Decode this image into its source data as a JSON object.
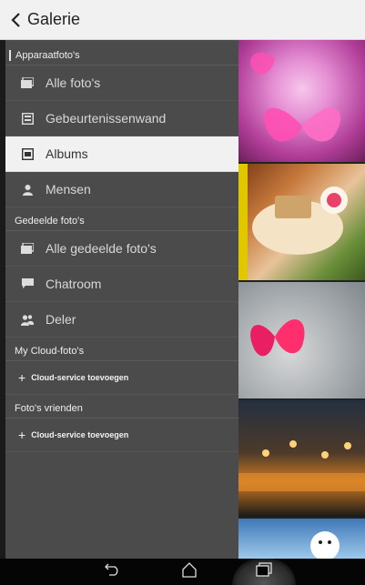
{
  "header": {
    "back_icon": "chevron-left-icon",
    "title": "Galerie"
  },
  "drawer": {
    "sections": [
      {
        "title": "Apparaatfoto's",
        "items": [
          {
            "label": "Alle foto's",
            "icon": "photos-icon"
          },
          {
            "label": "Gebeurtenissenwand",
            "icon": "event-wall-icon"
          },
          {
            "label": "Albums",
            "icon": "albums-icon",
            "selected": true
          },
          {
            "label": "Mensen",
            "icon": "people-icon"
          }
        ]
      },
      {
        "title": "Gedeelde foto's",
        "items": [
          {
            "label": "Alle gedeelde foto's",
            "icon": "photos-icon"
          },
          {
            "label": "Chatroom",
            "icon": "chat-icon"
          },
          {
            "label": "Deler",
            "icon": "sharer-icon"
          }
        ]
      },
      {
        "title": "My Cloud-foto's",
        "add_label": "Cloud-service toevoegen"
      },
      {
        "title": "Foto's vrienden",
        "add_label": "Cloud-service toevoegen"
      }
    ]
  },
  "gallery": {
    "thumbnails": [
      "butterfly-pink",
      "birthday-cake",
      "butterfly-stones",
      "autumn-park",
      "snowman"
    ]
  },
  "navbar": {
    "back_icon": "back-icon",
    "home_icon": "home-icon",
    "recent_icon": "recent-apps-icon"
  },
  "colors": {
    "drawer_bg": "#4b4b4b",
    "selected_bg": "#f1f1f1",
    "topbar_bg": "#f1f1f1"
  }
}
